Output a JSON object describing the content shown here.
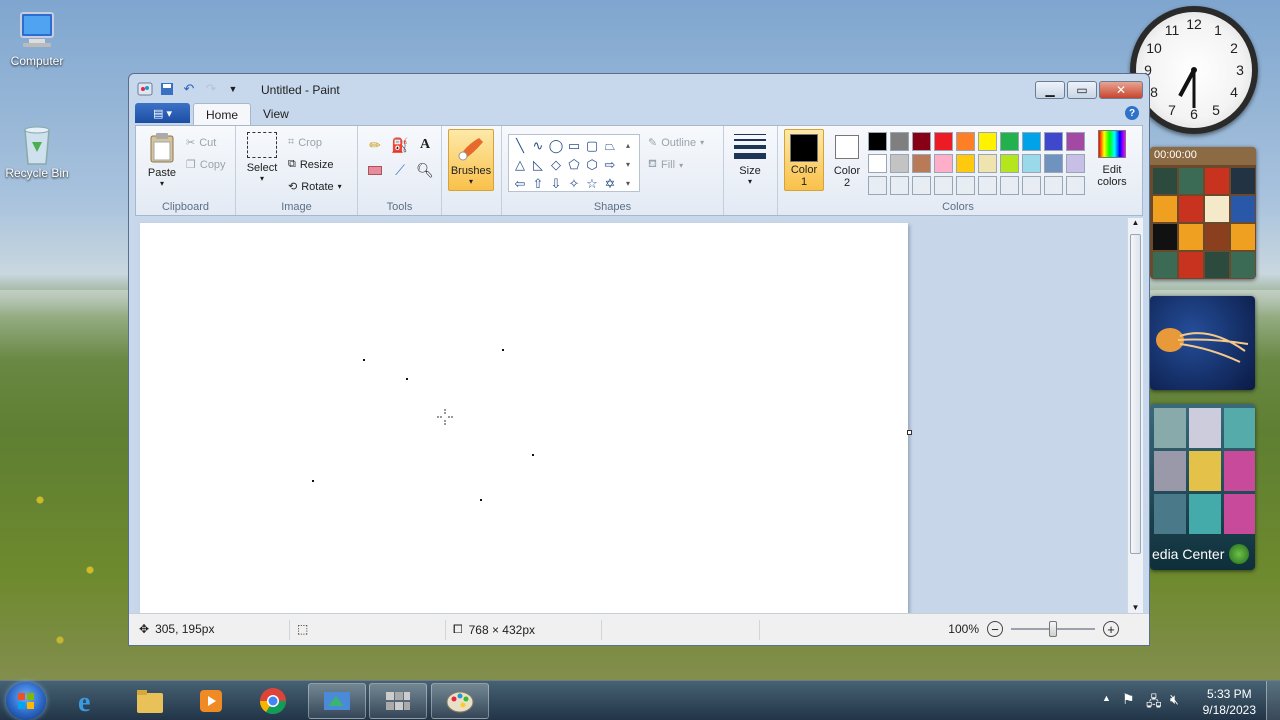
{
  "desktop": {
    "icons": [
      {
        "label": "Computer"
      },
      {
        "label": "Recycle Bin"
      }
    ],
    "clock_numbers": [
      "12",
      "1",
      "2",
      "3",
      "4",
      "5",
      "6",
      "7",
      "8",
      "9",
      "10",
      "11"
    ],
    "gadgets": {
      "puzzle_time": "00:00:00",
      "media_label": "edia Center"
    }
  },
  "window": {
    "title": "Untitled - Paint",
    "tabs": {
      "file_icon": "menu-icon",
      "home": "Home",
      "view": "View"
    },
    "ribbon": {
      "clipboard": {
        "paste": "Paste",
        "cut": "Cut",
        "copy": "Copy",
        "group": "Clipboard"
      },
      "image": {
        "select": "Select",
        "crop": "Crop",
        "resize": "Resize",
        "rotate": "Rotate",
        "group": "Image"
      },
      "tools": {
        "group": "Tools"
      },
      "brushes": {
        "label": "Brushes"
      },
      "shapes": {
        "outline": "Outline",
        "fill": "Fill",
        "group": "Shapes"
      },
      "size": {
        "label": "Size"
      },
      "colors": {
        "color1_line1": "Color",
        "color1_line2": "1",
        "color2_line1": "Color",
        "color2_line2": "2",
        "edit_line1": "Edit",
        "edit_line2": "colors",
        "group": "Colors",
        "color1": "#000000",
        "color2": "#ffffff",
        "palette": [
          "#000000",
          "#7f7f7f",
          "#880015",
          "#ed1c24",
          "#ff7f27",
          "#fff200",
          "#22b14c",
          "#00a2e8",
          "#3f48cc",
          "#a349a4",
          "#ffffff",
          "#c3c3c3",
          "#b97a57",
          "#ffaec9",
          "#ffc90e",
          "#efe4b0",
          "#b5e61d",
          "#99d9ea",
          "#7092be",
          "#c8bfe7",
          "#e8edf3",
          "#e8edf3",
          "#e8edf3",
          "#e8edf3",
          "#e8edf3",
          "#e8edf3",
          "#e8edf3",
          "#e8edf3",
          "#e8edf3",
          "#e8edf3"
        ]
      }
    },
    "status": {
      "position": "305, 195px",
      "canvas_size": "768 × 432px",
      "zoom": "100%",
      "zoom_minus": "−",
      "zoom_plus": "+"
    }
  },
  "taskbar": {
    "time": "5:33 PM",
    "date": "9/18/2023"
  }
}
